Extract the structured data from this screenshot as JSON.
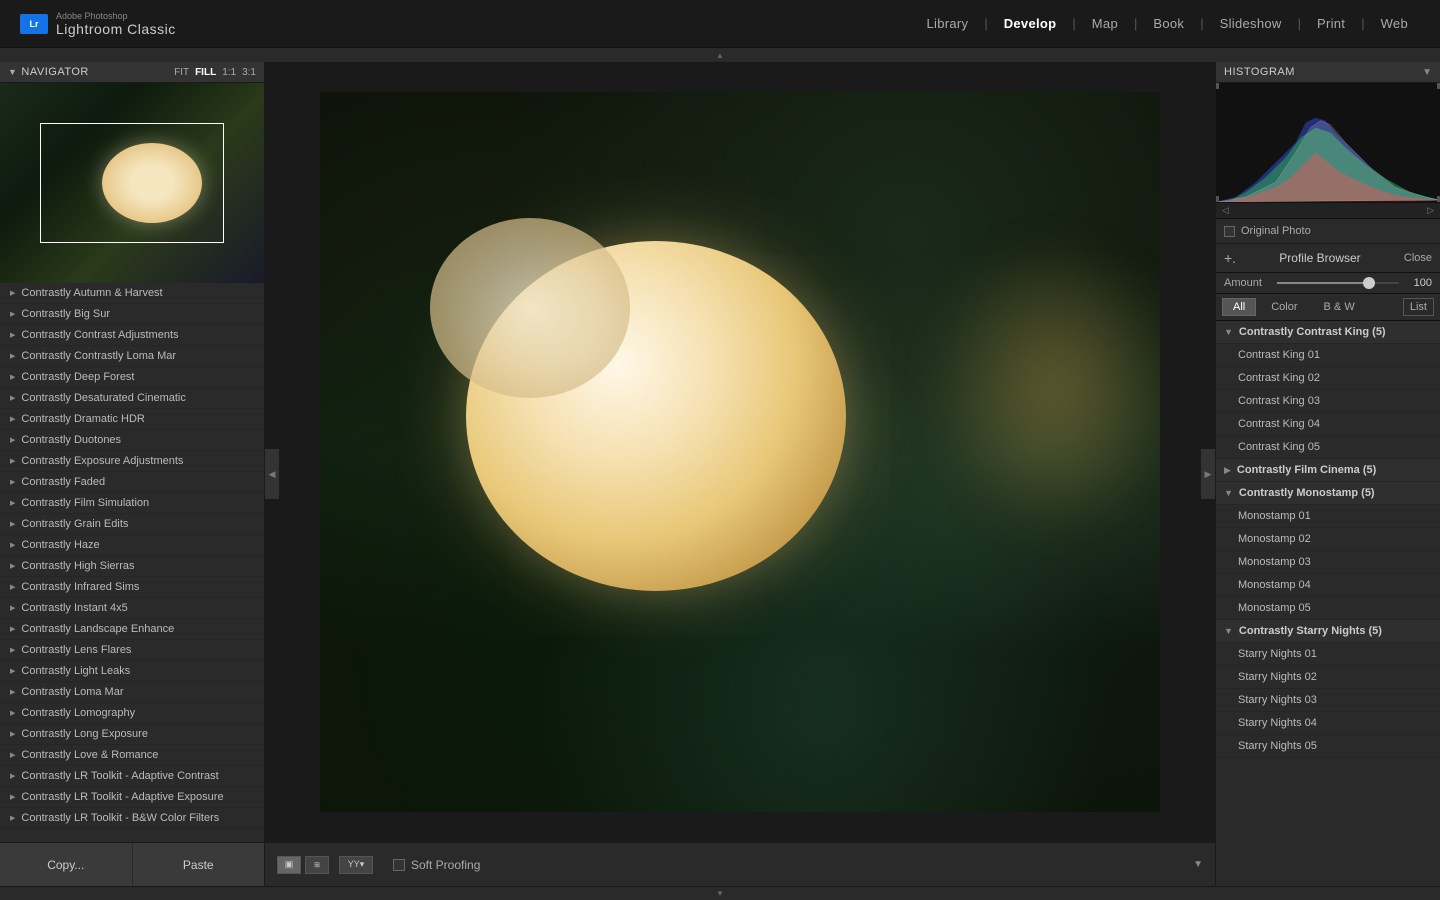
{
  "app": {
    "company": "Adobe Photoshop",
    "name": "Lightroom Classic",
    "lr_icon": "Lr"
  },
  "nav_tabs": {
    "items": [
      "Library",
      "Develop",
      "Map",
      "Book",
      "Slideshow",
      "Print",
      "Web"
    ],
    "active": "Develop",
    "separators": [
      0,
      1,
      2,
      3,
      4,
      5
    ]
  },
  "navigator": {
    "title": "Navigator",
    "zoom_options": [
      "FIT",
      "FILL",
      "1:1",
      "3:1"
    ],
    "active_zoom": "FILL"
  },
  "presets": [
    "Contrastly Autumn & Harvest",
    "Contrastly Big Sur",
    "Contrastly Contrast Adjustments",
    "Contrastly Contrastly Loma Mar",
    "Contrastly Deep Forest",
    "Contrastly Desaturated Cinematic",
    "Contrastly Dramatic HDR",
    "Contrastly Duotones",
    "Contrastly Exposure Adjustments",
    "Contrastly Faded",
    "Contrastly Film Simulation",
    "Contrastly Grain Edits",
    "Contrastly Haze",
    "Contrastly High Sierras",
    "Contrastly Infrared Sims",
    "Contrastly Instant 4x5",
    "Contrastly Landscape Enhance",
    "Contrastly Lens Flares",
    "Contrastly Light Leaks",
    "Contrastly Loma Mar",
    "Contrastly Lomography",
    "Contrastly Long Exposure",
    "Contrastly Love & Romance",
    "Contrastly LR Toolkit - Adaptive Contrast",
    "Contrastly LR Toolkit - Adaptive Exposure",
    "Contrastly LR Toolkit - B&W Color Filters"
  ],
  "bottom_buttons": {
    "copy": "Copy...",
    "paste": "Paste"
  },
  "toolbar": {
    "soft_proofing": "Soft Proofing"
  },
  "histogram": {
    "title": "Histogram",
    "original_photo_label": "Original Photo",
    "amount_label": "Amount",
    "amount_value": "100"
  },
  "profile_browser": {
    "title": "Profile Browser",
    "plus": "+.",
    "close_label": "Close"
  },
  "filter_tabs": {
    "items": [
      "All",
      "Color",
      "B & W",
      "List"
    ],
    "active": "All"
  },
  "profile_groups": [
    {
      "name": "Contrastly Contrast King (5)",
      "expanded": true,
      "entries": [
        "Contrast King 01",
        "Contrast King 02",
        "Contrast King 03",
        "Contrast King 04",
        "Contrast King 05"
      ]
    },
    {
      "name": "Contrastly Film Cinema (5)",
      "expanded": false,
      "entries": []
    },
    {
      "name": "Contrastly Monostamp (5)",
      "expanded": true,
      "entries": [
        "Monostamp 01",
        "Monostamp 02",
        "Monostamp 03",
        "Monostamp 04",
        "Monostamp 05"
      ]
    },
    {
      "name": "Contrastly Starry Nights (5)",
      "expanded": true,
      "entries": [
        "Starry Nights 01",
        "Starry Nights 02",
        "Starry Nights 03",
        "Starry Nights 04",
        "Starry Nights 05"
      ]
    }
  ]
}
